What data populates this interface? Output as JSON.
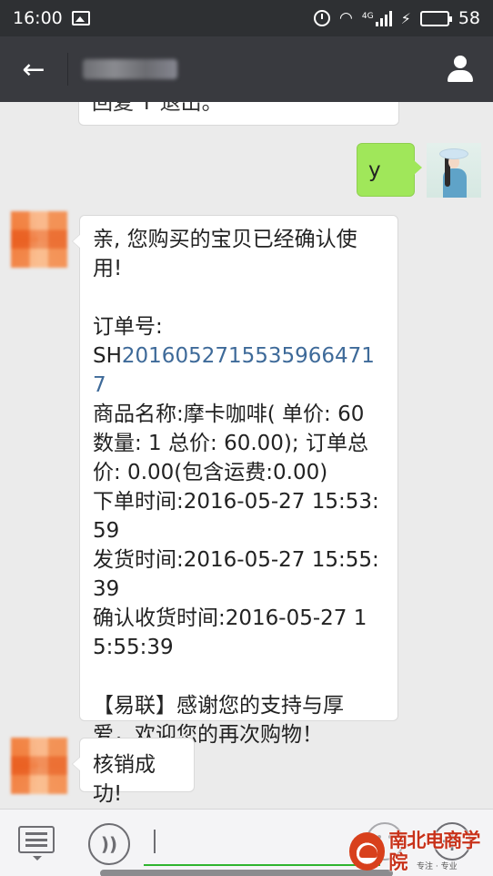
{
  "status_bar": {
    "time": "16:00",
    "network_type": "4G",
    "battery": "58",
    "battery_level_percent": 58,
    "icons": [
      "image-icon",
      "alarm-icon",
      "wifi-icon",
      "signal-icon",
      "charging-icon",
      "battery-icon"
    ],
    "battery_color": "#3fcf3b"
  },
  "header": {
    "back_icon": "←",
    "title_state": "blurred",
    "profile_icon": "person-icon",
    "background": "#393a3f"
  },
  "messages": {
    "previous_partial": "回复 T 退出。",
    "my_reply": "y",
    "receipt": {
      "line1": "亲, 您购买的宝贝已经确认使用!",
      "order_label": "订单号:",
      "order_prefix": "SH",
      "order_number": "2016052715535966471​7",
      "product": "商品名称:摩卡咖啡(  单价: 60 数量: 1 总价: 60.00);  订单总价: 0.00(包含运费:0.00)",
      "order_time": "下单时间:2016-05-27 15:53:59",
      "ship_time": "发货时间:2016-05-27 15:55:39",
      "confirm_time": "确认收货时间:2016-05-27 15:55:39",
      "thanks": "【易联】感谢您的支持与厚爱，欢迎您的再次购物！"
    },
    "verify_success": "核销成功!"
  },
  "input_bar": {
    "placeholder": "",
    "voice_icon": "voice-icon",
    "emoji_icon": "emoji-icon",
    "plus_icon": "+",
    "accent": "#2fb42f"
  },
  "watermark": {
    "title": "南北电商学院",
    "tagline": "专注 · 专业"
  },
  "colors": {
    "chat_background": "#ebebeb",
    "my_bubble": "#a0e75a",
    "link": "#3e6a99"
  }
}
